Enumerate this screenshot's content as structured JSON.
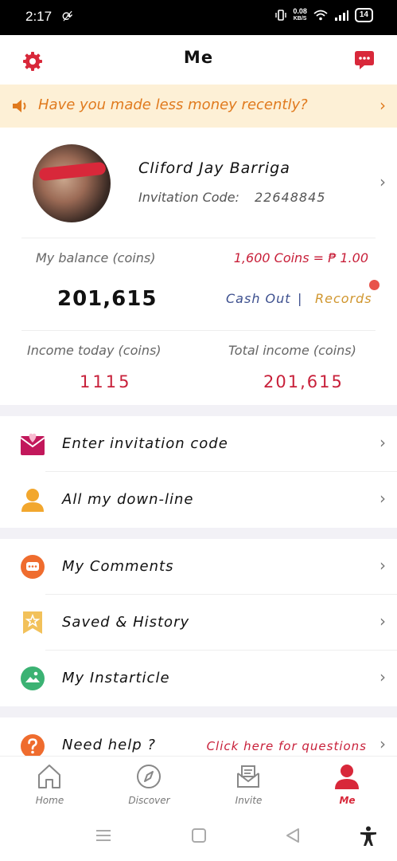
{
  "status_bar": {
    "time": "2:17",
    "net_speed_value": "0.08",
    "net_speed_unit": "KB/S",
    "battery": "14"
  },
  "header": {
    "title": "Me",
    "settings_icon": "gear-icon",
    "messages_icon": "chat-icon"
  },
  "banner": {
    "text": "Have you made less money recently?"
  },
  "profile": {
    "name": "Cliford Jay Barriga",
    "invitation_label": "Invitation Code:",
    "invitation_code": "22648845"
  },
  "balance": {
    "label": "My balance (coins)",
    "value": "201,615",
    "rate": "1,600 Coins = ₱ 1.00",
    "cash_out": "Cash Out",
    "separator": "|",
    "records": "Records"
  },
  "income": {
    "today_label": "Income today (coins)",
    "today_value": "1115",
    "total_label": "Total income (coins)",
    "total_value": "201,615"
  },
  "menu": {
    "enter_invitation": "Enter invitation code",
    "downline": "All my down-line",
    "comments": "My Comments",
    "saved_history": "Saved & History",
    "instarticle": "My Instarticle",
    "help": "Need help ?",
    "help_link": "Click here for questions"
  },
  "tabs": [
    {
      "label": "Home",
      "icon": "home-icon"
    },
    {
      "label": "Discover",
      "icon": "compass-icon"
    },
    {
      "label": "Invite",
      "icon": "envelope-icon"
    },
    {
      "label": "Me",
      "icon": "person-icon",
      "active": true
    }
  ],
  "colors": {
    "accent": "#d8283a",
    "banner_bg": "#fdf0d6",
    "banner_text": "#e07a1e",
    "link_blue": "#3c4f8e",
    "records": "#d0962e"
  }
}
